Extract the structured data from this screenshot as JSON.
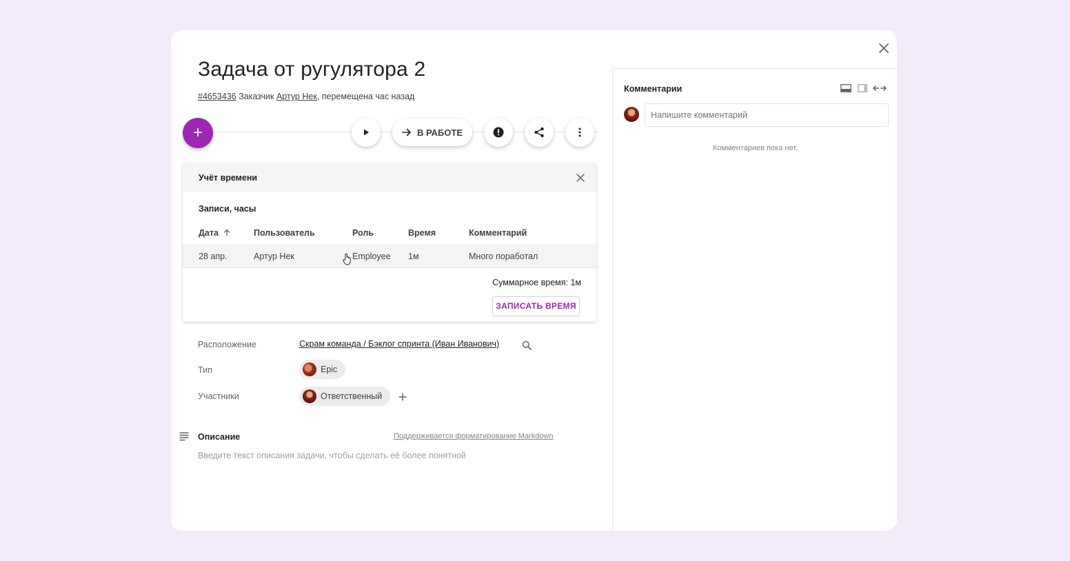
{
  "task": {
    "title": "Задача от ругулятора 2",
    "id_link": "#4653436",
    "customer_prefix": "Заказчик",
    "customer_name": "Артур Нек",
    "moved_text": ", перемещена час назад"
  },
  "toolbar": {
    "add_label": "+",
    "status_label": "В РАБОТЕ"
  },
  "time_tracking": {
    "title": "Учёт времени",
    "records_label": "Записи, часы",
    "columns": [
      "Дата",
      "Пользователь",
      "Роль",
      "Время",
      "Комментарий"
    ],
    "rows": [
      {
        "date": "28 апр.",
        "user": "Артур Нек",
        "role": "Employee",
        "time": "1м",
        "comment": "Много поработал"
      }
    ],
    "total": "Суммарное время: 1м",
    "record_button": "ЗАПИСАТЬ ВРЕМЯ"
  },
  "properties": {
    "location_label": "Расположение",
    "location_value": "Скрам команда / Бэклог спринта (Иван Иванович)",
    "type_label": "Тип",
    "type_value": "Epic",
    "participants_label": "Участники",
    "participant_value": "Ответственный"
  },
  "description": {
    "title": "Описание",
    "hint": "Поддерживается форматирование Markdown",
    "placeholder": "Введите текст описания задачи, чтобы сделать её более понятной"
  },
  "comments": {
    "title": "Комментарии",
    "input_placeholder": "Напишите комментарий",
    "empty_text": "Комментариев пока нет."
  },
  "colors": {
    "accent": "#9c27b0",
    "background": "#f1ebfa"
  }
}
